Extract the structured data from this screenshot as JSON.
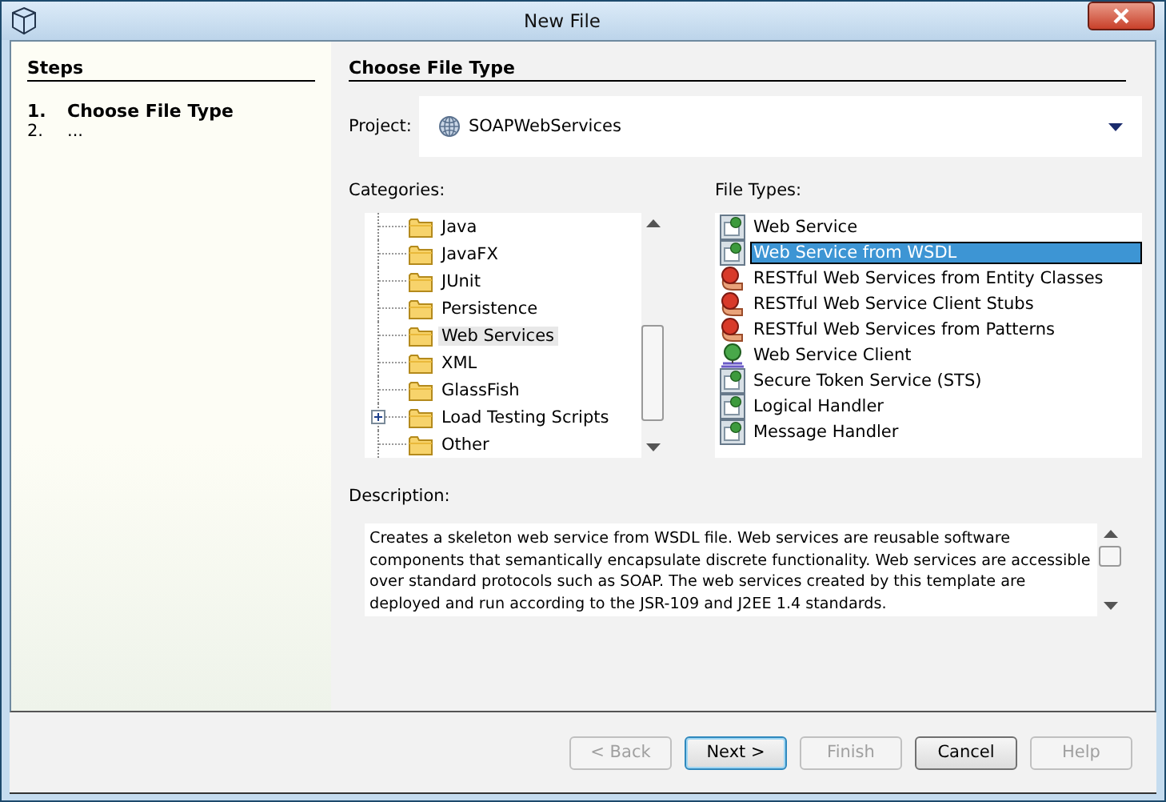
{
  "window": {
    "title": "New File"
  },
  "steps": {
    "title": "Steps",
    "items": [
      {
        "number": "1.",
        "label": "Choose File Type",
        "current": true
      },
      {
        "number": "2.",
        "label": "...",
        "current": false
      }
    ]
  },
  "panel": {
    "title": "Choose File Type"
  },
  "project": {
    "label": "Project:",
    "value": "SOAPWebServices"
  },
  "categories": {
    "label": "Categories:",
    "items": [
      {
        "label": "Java",
        "selected": false,
        "expandable": false
      },
      {
        "label": "JavaFX",
        "selected": false,
        "expandable": false
      },
      {
        "label": "JUnit",
        "selected": false,
        "expandable": false
      },
      {
        "label": "Persistence",
        "selected": false,
        "expandable": false
      },
      {
        "label": "Web Services",
        "selected": true,
        "expandable": false
      },
      {
        "label": "XML",
        "selected": false,
        "expandable": false
      },
      {
        "label": "GlassFish",
        "selected": false,
        "expandable": false
      },
      {
        "label": "Load Testing Scripts",
        "selected": false,
        "expandable": true
      },
      {
        "label": "Other",
        "selected": false,
        "expandable": false
      }
    ]
  },
  "file_types": {
    "label": "File Types:",
    "items": [
      {
        "label": "Web Service",
        "kind": "service",
        "selected": false
      },
      {
        "label": "Web Service from WSDL",
        "kind": "service",
        "selected": true
      },
      {
        "label": "RESTful Web Services from Entity Classes",
        "kind": "rest",
        "selected": false
      },
      {
        "label": "RESTful Web Service Client Stubs",
        "kind": "rest",
        "selected": false
      },
      {
        "label": "RESTful Web Services from Patterns",
        "kind": "rest",
        "selected": false
      },
      {
        "label": "Web Service Client",
        "kind": "client",
        "selected": false
      },
      {
        "label": "Secure Token Service (STS)",
        "kind": "service",
        "selected": false
      },
      {
        "label": "Logical Handler",
        "kind": "service",
        "selected": false
      },
      {
        "label": "Message Handler",
        "kind": "service",
        "selected": false
      }
    ]
  },
  "description": {
    "label": "Description:",
    "text": "Creates a skeleton web service from WSDL file. Web services are reusable software components that semantically encapsulate discrete functionality. Web services are accessible over standard protocols such as SOAP. The web services created by this template are deployed and run according to the JSR-109 and J2EE 1.4 standards."
  },
  "buttons": [
    {
      "label": "< Back",
      "disabled": true,
      "default": false
    },
    {
      "label": "Next >",
      "disabled": false,
      "default": true
    },
    {
      "label": "Finish",
      "disabled": true,
      "default": false
    },
    {
      "label": "Cancel",
      "disabled": false,
      "default": false
    },
    {
      "label": "Help",
      "disabled": true,
      "default": false
    }
  ]
}
